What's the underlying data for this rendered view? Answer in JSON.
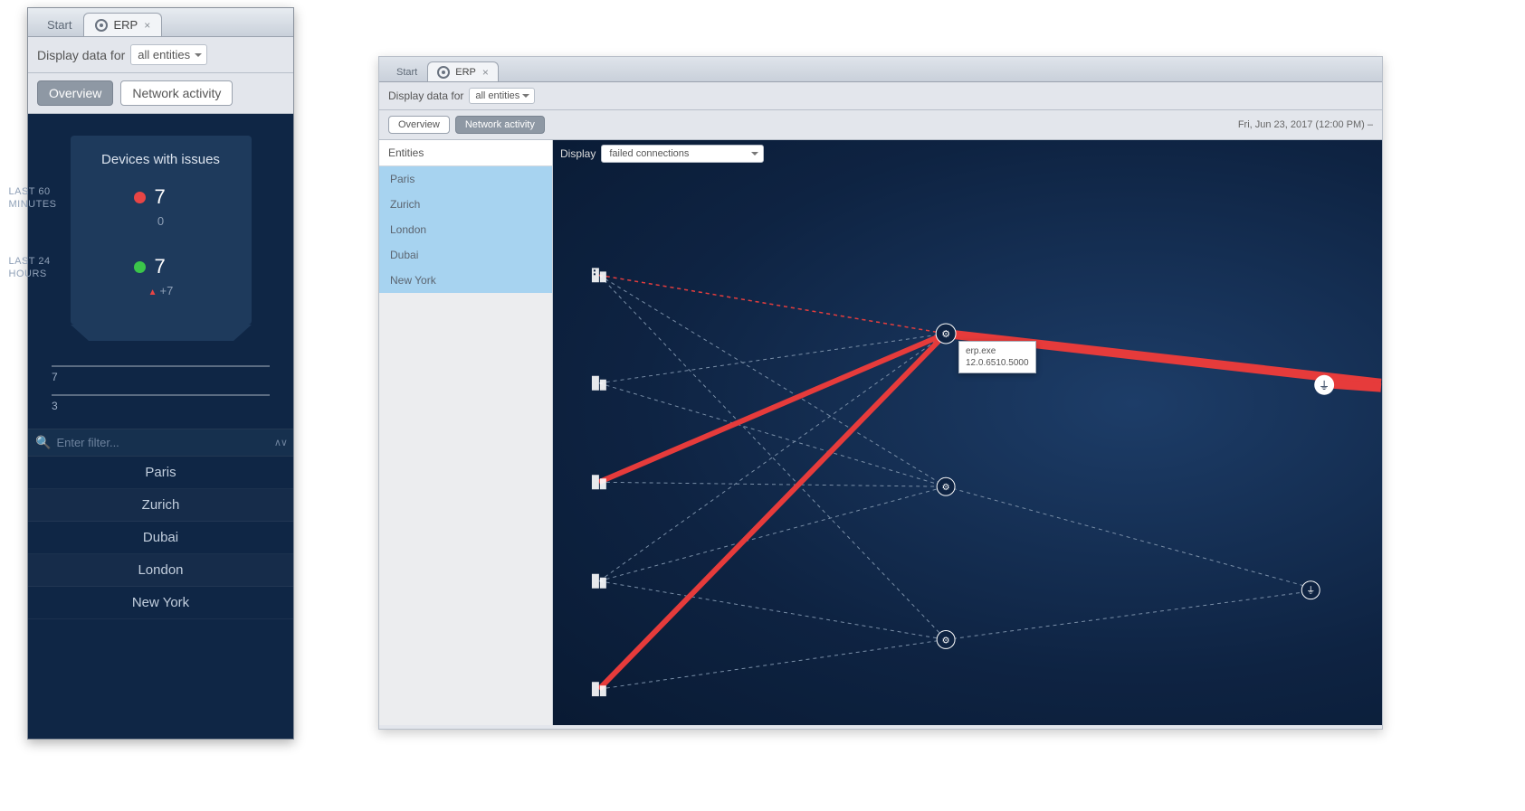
{
  "tabs": {
    "start": "Start",
    "erp": "ERP"
  },
  "toolbar": {
    "display_label": "Display data for",
    "entity_scope": "all entities"
  },
  "buttons": {
    "overview": "Overview",
    "network": "Network activity"
  },
  "issues": {
    "title": "Devices with issues",
    "last60_label": "LAST 60 MINUTES",
    "last60_value": "7",
    "last60_sub": "0",
    "last24_label": "LAST 24 HOURS",
    "last24_value": "7",
    "last24_delta": "+7",
    "scale_a": "7",
    "scale_b": "3"
  },
  "filter": {
    "placeholder": "Enter filter...",
    "sorter": "∧ ∨"
  },
  "left_entities": [
    "Paris",
    "Zurich",
    "Dubai",
    "London",
    "New York"
  ],
  "right": {
    "timestamp": "Fri, Jun 23, 2017 (12:00 PM) –",
    "entities_header": "Entities",
    "entities": [
      "Paris",
      "Zurich",
      "London",
      "Dubai",
      "New York"
    ],
    "display_label": "Display",
    "display_value": "failed connections",
    "tooltip_name": "erp.exe",
    "tooltip_ver": "12.0.6510.5000"
  }
}
